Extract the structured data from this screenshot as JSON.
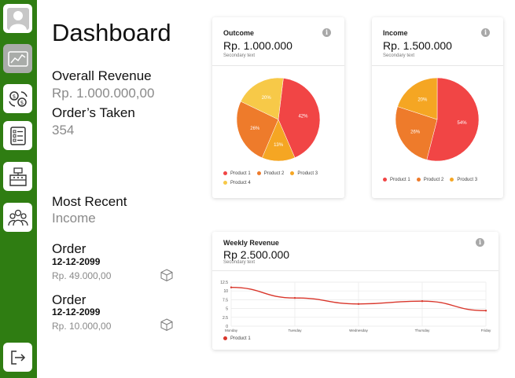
{
  "sidebar": {
    "items": [
      {
        "icon": "user-avatar-icon"
      },
      {
        "icon": "dashboard-chart-icon",
        "active": true
      },
      {
        "icon": "money-exchange-icon"
      },
      {
        "icon": "order-list-icon"
      },
      {
        "icon": "cash-register-icon"
      },
      {
        "icon": "users-group-icon"
      }
    ],
    "logout_icon": "logout-icon"
  },
  "page": {
    "title": "Dashboard"
  },
  "summary": {
    "revenue_label": "Overall Revenue",
    "revenue_value": "Rp. 1.000.000,00",
    "orders_label": "Order’s Taken",
    "orders_value": "354",
    "recent_label": "Most Recent",
    "recent_sub": "Income",
    "orders": [
      {
        "title": "Order",
        "date": "12-12-2099",
        "amount": "Rp. 49.000,00"
      },
      {
        "title": "Order",
        "date": "12-12-2099",
        "amount": "Rp. 10.000,00"
      }
    ]
  },
  "cards": {
    "outcome": {
      "label": "Outcome",
      "value": "Rp. 1.000.000",
      "sub": "Secondary text"
    },
    "income": {
      "label": "Income",
      "value": "Rp. 1.500.000",
      "sub": "Secondary text"
    },
    "weekly": {
      "label": "Weekly Revenue",
      "value": "Rp 2.500.000",
      "sub": "Secondary text"
    }
  },
  "colors": {
    "sidebar": "#2f7d12",
    "product1": "#f14545",
    "product2": "#ee7b2b",
    "product3": "#f5a623",
    "product4": "#f7c948",
    "line": "#d9362b"
  },
  "chart_data": [
    {
      "type": "pie",
      "title": "Outcome",
      "series": [
        {
          "name": "Product 1",
          "value": 42
        },
        {
          "name": "Product 2",
          "value": 26
        },
        {
          "name": "Product 3",
          "value": 13
        },
        {
          "name": "Product 4",
          "value": 20
        }
      ],
      "labels": [
        "42%",
        "26%",
        "13%",
        "20%"
      ],
      "legend": [
        "Product 1",
        "Product 2",
        "Product 3",
        "Product 4"
      ]
    },
    {
      "type": "pie",
      "title": "Income",
      "series": [
        {
          "name": "Product 1",
          "value": 54
        },
        {
          "name": "Product 2",
          "value": 26
        },
        {
          "name": "Product 3",
          "value": 20
        }
      ],
      "labels": [
        "54%",
        "26%",
        "20%"
      ],
      "legend": [
        "Product 1",
        "Product 2",
        "Product 3"
      ]
    },
    {
      "type": "line",
      "title": "Weekly Revenue",
      "categories": [
        "Monday",
        "Tuesday",
        "Wednesday",
        "Thursday",
        "Friday"
      ],
      "series": [
        {
          "name": "Product 1",
          "values": [
            11,
            8,
            6.3,
            7.1,
            4.4
          ]
        }
      ],
      "ylim": [
        0,
        12.5
      ],
      "yticks": [
        "12.5",
        "10",
        "7.5",
        "5",
        "2.5",
        "0"
      ],
      "grid": true,
      "legend": "bottom-left"
    }
  ]
}
